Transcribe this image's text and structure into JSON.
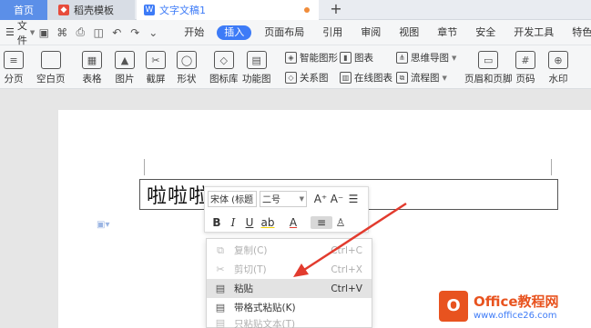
{
  "tabs": [
    {
      "label": "首页"
    },
    {
      "label": "稻壳模板"
    },
    {
      "label": "文字文稿1"
    }
  ],
  "menu": {
    "file_label": "文件",
    "items": [
      "开始",
      "插入",
      "页面布局",
      "引用",
      "审阅",
      "视图",
      "章节",
      "安全",
      "开发工具",
      "特色"
    ],
    "active": "插入"
  },
  "ribbon": {
    "pagination": "分页",
    "blank_page": "空白页",
    "table": "表格",
    "picture": "图片",
    "screenshot": "截屏",
    "shape": "形状",
    "icon_lib": "图标库",
    "function_chart": "功能图",
    "smart_shape": "智能图形",
    "chart": "图表",
    "mind_map": "思维导图",
    "relation": "关系图",
    "online_chart": "在线图表",
    "flowchart": "流程图",
    "header_footer": "页眉和页脚",
    "page_number": "页码",
    "watermark": "水印"
  },
  "document": {
    "text": "啦啦啦"
  },
  "mini_toolbar": {
    "font": "宋体 (标题",
    "size": "二号",
    "bold": "B",
    "italic": "I",
    "underline": "U",
    "highlight": "ab",
    "font_color": "A"
  },
  "context_menu": {
    "items": [
      {
        "label": "复制(C)",
        "shortcut": "Ctrl+C",
        "icon": "copy-icon"
      },
      {
        "label": "剪切(T)",
        "shortcut": "Ctrl+X",
        "icon": "cut-icon"
      },
      {
        "label": "粘贴",
        "shortcut": "Ctrl+V",
        "icon": "paste-icon"
      },
      {
        "label": "带格式粘贴(K)",
        "shortcut": "",
        "icon": "paste-format-icon"
      },
      {
        "label": "只粘贴文本(T)",
        "shortcut": "",
        "icon": "paste-text-icon"
      }
    ]
  },
  "watermark": {
    "logo": "O",
    "title": "Office教程网",
    "url": "www.office26.com"
  },
  "colors": {
    "accent": "#3d7bf7",
    "arrow": "#e23b2e",
    "brand": "#e8531f"
  }
}
